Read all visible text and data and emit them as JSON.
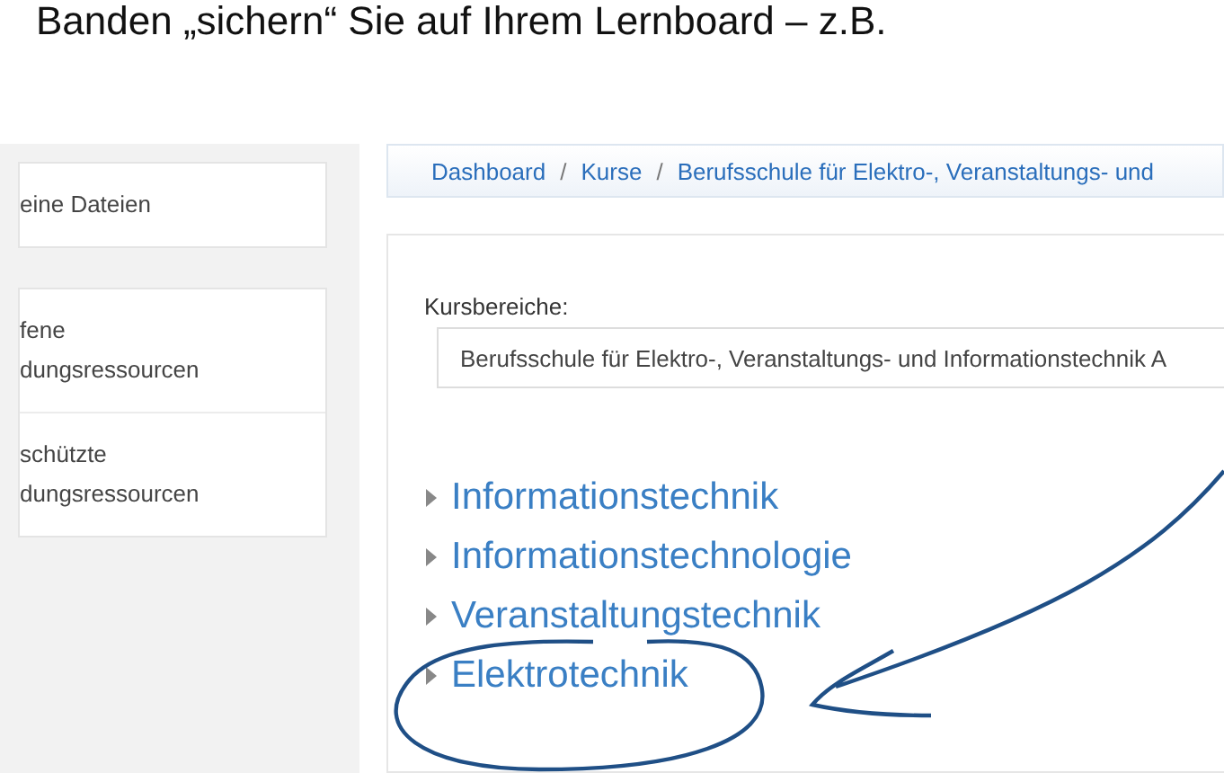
{
  "heading": "Banden „sichern“ Sie auf Ihrem Lernboard – z.B.",
  "sidebar": {
    "items": [
      {
        "lines": [
          "eine Dateien"
        ]
      },
      {
        "lines": [
          "fene",
          "dungsressourcen"
        ]
      },
      {
        "lines": [
          "schützte",
          "dungsressourcen"
        ]
      }
    ]
  },
  "breadcrumb": {
    "separator": "/",
    "items": [
      "Dashboard",
      "Kurse",
      "Berufsschule für Elektro-, Veranstaltungs- und"
    ]
  },
  "category_select": {
    "label": "Kursbereiche:",
    "value": "Berufsschule für Elektro-, Veranstaltungs- und Informationstechnik A"
  },
  "categories": [
    {
      "label": "Informationstechnik",
      "expanded": false
    },
    {
      "label": "Informationstechnologie",
      "expanded": false
    },
    {
      "label": "Veranstaltungstechnik",
      "expanded": false
    },
    {
      "label": "Elektrotechnik",
      "expanded": false
    }
  ]
}
